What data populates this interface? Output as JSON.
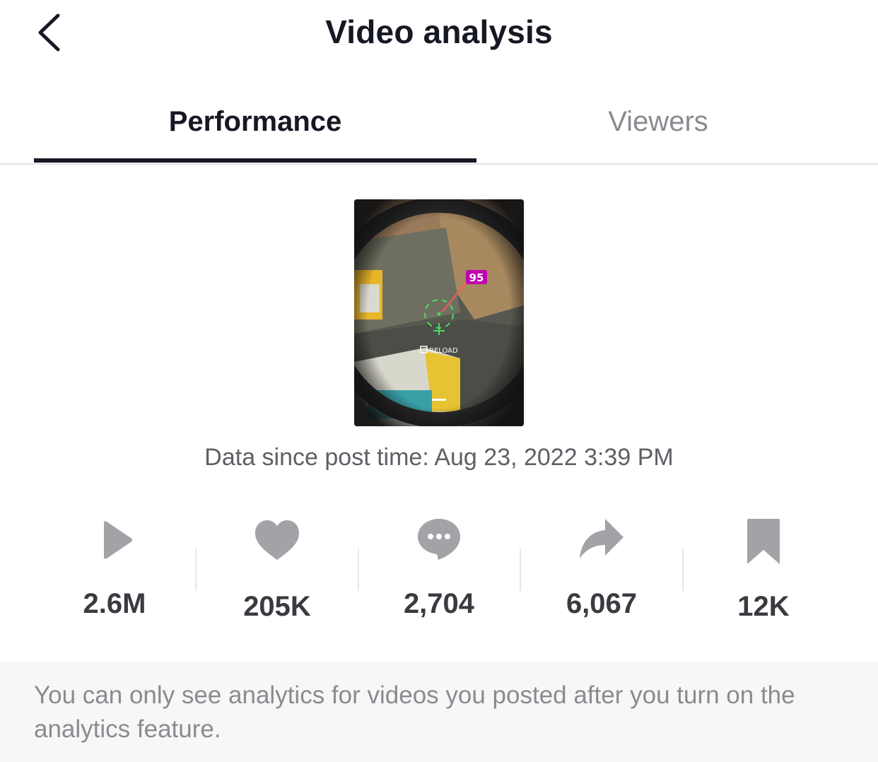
{
  "header": {
    "title": "Video analysis",
    "back_icon": "chevron-left-icon"
  },
  "tabs": [
    {
      "label": "Performance",
      "active": true
    },
    {
      "label": "Viewers",
      "active": false
    }
  ],
  "video": {
    "thumbnail_text": [
      "95",
      "RELOAD"
    ]
  },
  "post_time": "Data since post time: Aug 23, 2022 3:39 PM",
  "stats": [
    {
      "icon": "play-icon",
      "value": "2.6M"
    },
    {
      "icon": "heart-icon",
      "value": "205K"
    },
    {
      "icon": "comment-icon",
      "value": "2,704"
    },
    {
      "icon": "share-icon",
      "value": "6,067"
    },
    {
      "icon": "bookmark-icon",
      "value": "12K"
    }
  ],
  "footer": {
    "note": "You can only see analytics for videos you posted after you turn on the analytics feature."
  },
  "colors": {
    "text_primary": "#161823",
    "text_secondary": "#8a8b91",
    "icon_gray": "#a2a3a7",
    "footer_bg": "#f7f7f7",
    "damage_badge": "#c000b0",
    "crosshair": "#4cd964"
  }
}
